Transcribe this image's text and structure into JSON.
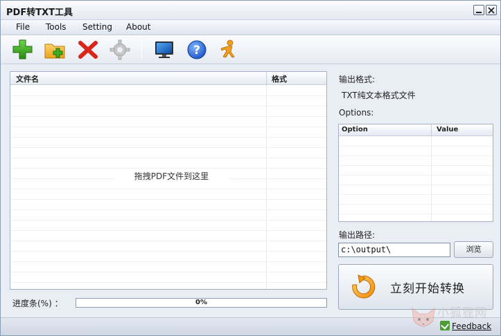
{
  "window": {
    "title": "PDF转TXT工具"
  },
  "menu": {
    "items": [
      "File",
      "Tools",
      "Setting",
      "About"
    ]
  },
  "toolbar": {
    "icons": [
      "add-file-icon",
      "add-folder-icon",
      "delete-icon",
      "settings-gear-icon",
      "monitor-icon",
      "help-icon",
      "runner-icon"
    ]
  },
  "file_list": {
    "columns": [
      "文件名",
      "格式"
    ],
    "rows": [],
    "empty_hint": "拖拽PDF文件到这里"
  },
  "progress": {
    "label": "进度条(%) ：",
    "value_text": "0%",
    "value": 0
  },
  "output": {
    "format_label": "输出格式:",
    "format_value": "TXT纯文本格式文件",
    "options_label": "Options:",
    "options_columns": [
      "Option",
      "Value"
    ],
    "options_rows": [],
    "path_label": "输出路径:",
    "path_value": "c:\\output\\",
    "browse_label": "浏览",
    "convert_label": "立刻开始转换"
  },
  "status": {
    "feedback_label": "Feedback"
  },
  "watermark": {
    "text": "小狐狸网"
  },
  "colors": {
    "accent": "#1f6fd6",
    "add_green": "#3aa41e",
    "delete_red": "#d9261c",
    "runner_orange": "#f0a020"
  }
}
